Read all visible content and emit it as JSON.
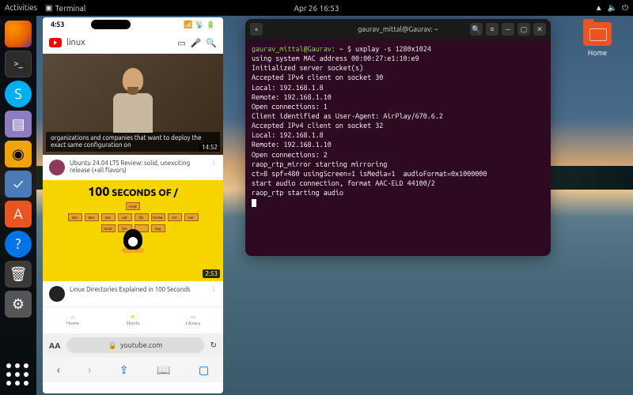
{
  "topbar": {
    "activities": "Activities",
    "app_indicator": "Terminal",
    "datetime": "Apr 26  16:53"
  },
  "dock": {
    "items": [
      {
        "name": "firefox",
        "glyph": ""
      },
      {
        "name": "terminal",
        "glyph": ">_"
      },
      {
        "name": "skype",
        "glyph": "S"
      },
      {
        "name": "files",
        "glyph": "▤"
      },
      {
        "name": "rhythmbox",
        "glyph": "◉"
      },
      {
        "name": "todo",
        "glyph": "✓"
      },
      {
        "name": "software",
        "glyph": "A"
      },
      {
        "name": "help",
        "glyph": "?"
      },
      {
        "name": "trash",
        "glyph": "🗑"
      },
      {
        "name": "settings",
        "glyph": "⚙"
      }
    ]
  },
  "desktop": {
    "home_label": "Home"
  },
  "phone": {
    "status_time": "4:53",
    "search_query": "linux",
    "video1": {
      "caption": "organizations and companies that want to deploy the exact same configuration on",
      "duration": "14:52"
    },
    "meta1": {
      "title": "Ubuntu 24.04 LTS Review: solid, unexciting release (+all flavors)"
    },
    "video2": {
      "banner_prefix": "100",
      "banner_rest": " SECONDS OF /",
      "duration": "2:53"
    },
    "meta2": {
      "title": "Linux Directories Explained in 100 Seconds"
    },
    "tabs": {
      "home": "Home",
      "shorts": "Shorts",
      "library": "Library"
    },
    "addr": {
      "aa": "AA",
      "url": "youtube.com"
    }
  },
  "terminal": {
    "title": "gaurav_mittal@Gaurav: ~",
    "prompt_user": "gaurav_mittal@Gaurav:",
    "prompt_path": "~",
    "command": "uxplay -s 1280x1024",
    "lines": [
      "using system MAC address 00:00:27:e1:10:e9",
      "Initialized server socket(s)",
      "Accepted IPv4 client on socket 30",
      "Local: 192.168.1.8",
      "Remote: 192.168.1.10",
      "Open connections: 1",
      "Client identified as User-Agent: AirPlay/670.6.2",
      "Accepted IPv4 client on socket 32",
      "Local: 192.168.1.8",
      "Remote: 192.168.1.10",
      "Open connections: 2",
      "raop_rtp_mirror starting mirroring",
      "ct=8 spf=480 usingScreen=1 isMedia=1  audioFormat=0x1000000",
      "start audio connection, format AAC-ELD 44100/2",
      "raop_rtp starting audio"
    ]
  }
}
